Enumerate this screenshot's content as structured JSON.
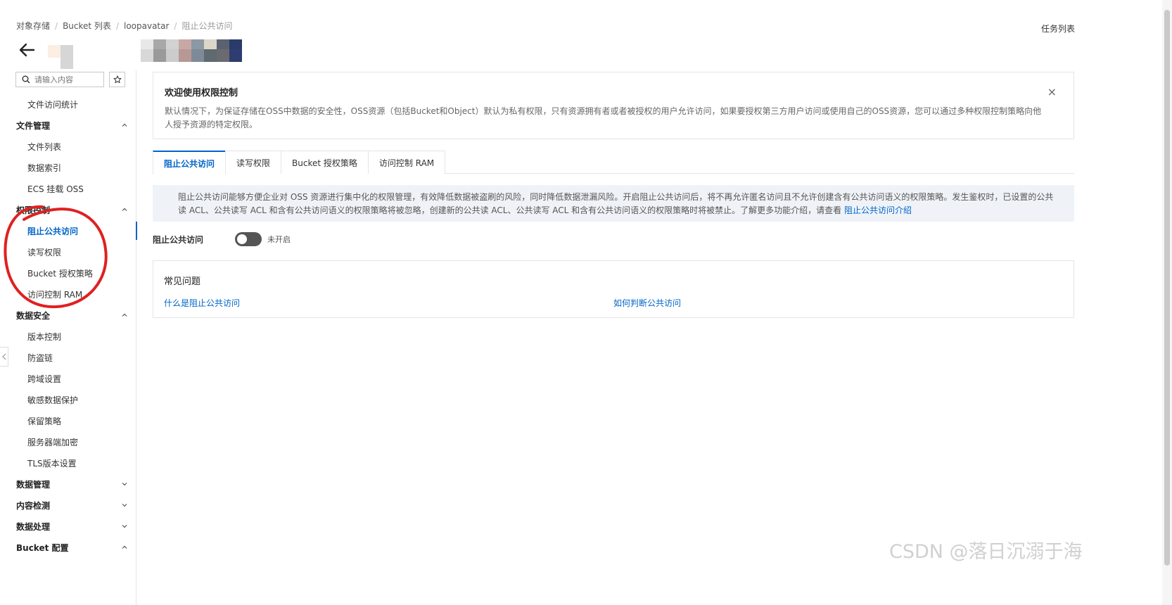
{
  "breadcrumb": {
    "items": [
      "对象存储",
      "Bucket 列表",
      "loopavatar"
    ],
    "current": "阻止公共访问"
  },
  "header": {
    "task_list": "任务列表"
  },
  "sidebar": {
    "search_placeholder": "请输入内容",
    "entries": [
      {
        "type": "item",
        "label": "文件访问统计"
      },
      {
        "type": "group",
        "label": "文件管理",
        "expanded": true
      },
      {
        "type": "item",
        "label": "文件列表"
      },
      {
        "type": "item",
        "label": "数据索引"
      },
      {
        "type": "item",
        "label": "ECS 挂载 OSS"
      },
      {
        "type": "group",
        "label": "权限控制",
        "expanded": true
      },
      {
        "type": "item",
        "label": "阻止公共访问",
        "active": true
      },
      {
        "type": "item",
        "label": "读写权限"
      },
      {
        "type": "item",
        "label": "Bucket 授权策略"
      },
      {
        "type": "item",
        "label": "访问控制 RAM"
      },
      {
        "type": "group",
        "label": "数据安全",
        "expanded": true
      },
      {
        "type": "item",
        "label": "版本控制"
      },
      {
        "type": "item",
        "label": "防盗链"
      },
      {
        "type": "item",
        "label": "跨域设置"
      },
      {
        "type": "item",
        "label": "敏感数据保护"
      },
      {
        "type": "item",
        "label": "保留策略"
      },
      {
        "type": "item",
        "label": "服务器端加密"
      },
      {
        "type": "item",
        "label": "TLS版本设置"
      },
      {
        "type": "group",
        "label": "数据管理",
        "expanded": false
      },
      {
        "type": "group",
        "label": "内容检测",
        "expanded": false
      },
      {
        "type": "group",
        "label": "数据处理",
        "expanded": false
      },
      {
        "type": "group",
        "label": "Bucket 配置",
        "expanded": true
      }
    ]
  },
  "welcome": {
    "title": "欢迎使用权限控制",
    "text": "默认情况下，为保证存储在OSS中数据的安全性，OSS资源（包括Bucket和Object）默认为私有权限，只有资源拥有者或者被授权的用户允许访问，如果要授权第三方用户访问或使用自己的OSS资源，您可以通过多种权限控制策略向他人授予资源的特定权限。",
    "close": "×"
  },
  "tabs": [
    {
      "label": "阻止公共访问",
      "active": true
    },
    {
      "label": "读写权限"
    },
    {
      "label": "Bucket 授权策略"
    },
    {
      "label": "访问控制 RAM"
    }
  ],
  "info": {
    "text": "阻止公共访问能够方便企业对 OSS 资源进行集中化的权限管理，有效降低数据被盗刷的风险，同时降低数据泄漏风险。开启阻止公共访问后，将不再允许匿名访问且不允许创建含有公共访问语义的权限策略。发生鉴权时，已设置的公共读 ACL、公共读写 ACL 和含有公共访问语义的权限策略将被忽略，创建新的公共读 ACL、公共读写 ACL 和含有公共访问语义的权限策略时将被禁止。了解更多功能介绍，请查看 ",
    "link": "阻止公共访问介绍"
  },
  "block_public": {
    "label": "阻止公共访问",
    "state": "未开启",
    "enabled": false
  },
  "faq": {
    "title": "常见问题",
    "links": [
      "什么是阻止公共访问",
      "如何判断公共访问"
    ]
  },
  "watermark": "CSDN @落日沉溺于海",
  "colors": {
    "accent": "#0064c8",
    "annotation": "#e02020",
    "info_bg": "#eff3f8"
  }
}
